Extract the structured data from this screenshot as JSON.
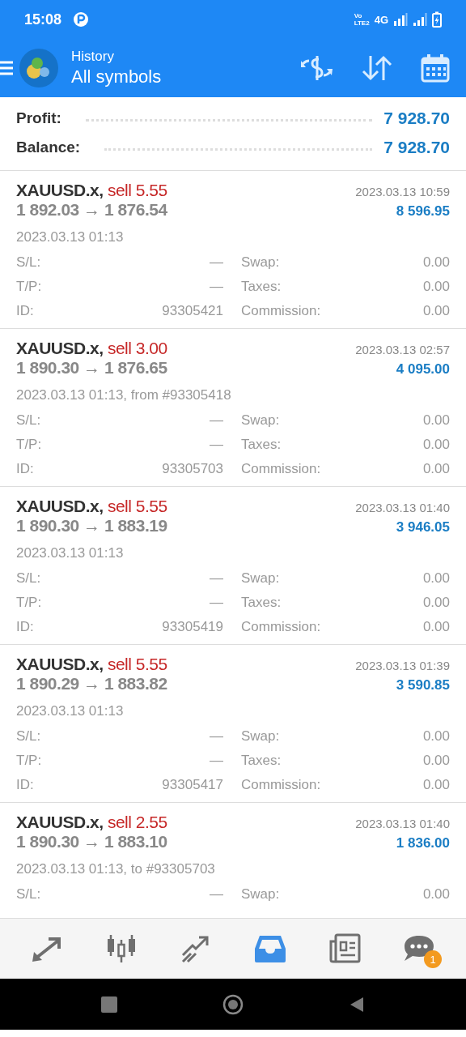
{
  "status_bar": {
    "time": "15:08",
    "volte_top": "Vo",
    "volte_bottom": "LTE2",
    "network": "4G"
  },
  "header": {
    "subtitle": "History",
    "title": "All symbols"
  },
  "summary": [
    {
      "label": "Profit:",
      "value": "7 928.70"
    },
    {
      "label": "Balance:",
      "value": "7 928.70"
    }
  ],
  "trades": [
    {
      "symbol": "XAUUSD.x,",
      "side": "sell 5.55",
      "prices": "1 892.03 → 1 876.54",
      "close_time": "2023.03.13 10:59",
      "profit": "8 596.95",
      "open_line": "2023.03.13 01:13",
      "details": [
        [
          "S/L:",
          "—",
          "Swap:",
          "0.00"
        ],
        [
          "T/P:",
          "—",
          "Taxes:",
          "0.00"
        ],
        [
          "ID:",
          "93305421",
          "Commission:",
          "0.00"
        ]
      ]
    },
    {
      "symbol": "XAUUSD.x,",
      "side": "sell 3.00",
      "prices": "1 890.30 → 1 876.65",
      "close_time": "2023.03.13 02:57",
      "profit": "4 095.00",
      "open_line": "2023.03.13 01:13, from #93305418",
      "details": [
        [
          "S/L:",
          "—",
          "Swap:",
          "0.00"
        ],
        [
          "T/P:",
          "—",
          "Taxes:",
          "0.00"
        ],
        [
          "ID:",
          "93305703",
          "Commission:",
          "0.00"
        ]
      ]
    },
    {
      "symbol": "XAUUSD.x,",
      "side": "sell 5.55",
      "prices": "1 890.30 → 1 883.19",
      "close_time": "2023.03.13 01:40",
      "profit": "3 946.05",
      "open_line": "2023.03.13 01:13",
      "details": [
        [
          "S/L:",
          "—",
          "Swap:",
          "0.00"
        ],
        [
          "T/P:",
          "—",
          "Taxes:",
          "0.00"
        ],
        [
          "ID:",
          "93305419",
          "Commission:",
          "0.00"
        ]
      ]
    },
    {
      "symbol": "XAUUSD.x,",
      "side": "sell 5.55",
      "prices": "1 890.29 → 1 883.82",
      "close_time": "2023.03.13 01:39",
      "profit": "3 590.85",
      "open_line": "2023.03.13 01:13",
      "details": [
        [
          "S/L:",
          "—",
          "Swap:",
          "0.00"
        ],
        [
          "T/P:",
          "—",
          "Taxes:",
          "0.00"
        ],
        [
          "ID:",
          "93305417",
          "Commission:",
          "0.00"
        ]
      ]
    },
    {
      "symbol": "XAUUSD.x,",
      "side": "sell 2.55",
      "prices": "1 890.30 → 1 883.10",
      "close_time": "2023.03.13 01:40",
      "profit": "1 836.00",
      "open_line": "2023.03.13 01:13, to #93305703",
      "details": [
        [
          "S/L:",
          "—",
          "Swap:",
          "0.00"
        ]
      ]
    }
  ],
  "bottom_nav": [
    {
      "kind": "quotes",
      "selected": false
    },
    {
      "kind": "chart",
      "selected": false
    },
    {
      "kind": "trade",
      "selected": false
    },
    {
      "kind": "history",
      "selected": true
    },
    {
      "kind": "news",
      "selected": false
    },
    {
      "kind": "chat",
      "selected": false,
      "badge": "1"
    }
  ]
}
